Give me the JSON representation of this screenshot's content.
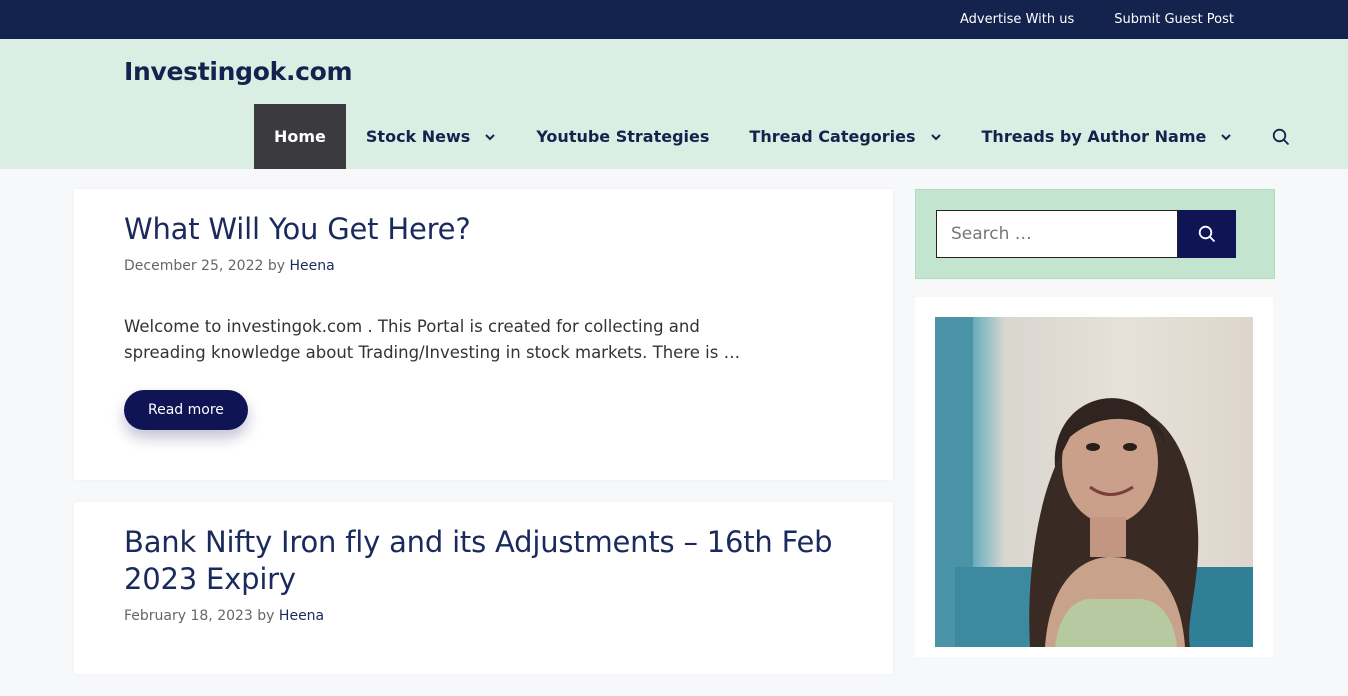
{
  "topbar": {
    "links": [
      "Advertise With us",
      "Submit Guest Post"
    ]
  },
  "site": {
    "title": "Investingok.com"
  },
  "nav": {
    "items": [
      {
        "label": "Home",
        "active": true,
        "dropdown": false
      },
      {
        "label": "Stock News",
        "active": false,
        "dropdown": true
      },
      {
        "label": "Youtube Strategies",
        "active": false,
        "dropdown": false
      },
      {
        "label": "Thread Categories",
        "active": false,
        "dropdown": true
      },
      {
        "label": "Threads by Author Name",
        "active": false,
        "dropdown": true
      }
    ],
    "search_icon": "search-icon"
  },
  "posts": [
    {
      "title": "What Will You Get Here?",
      "date": "December 25, 2022",
      "by": "by",
      "author": "Heena",
      "excerpt": "Welcome to investingok.com . This Portal is created for collecting and spreading knowledge about Trading/Investing in stock markets. There is …",
      "read_more": "Read more"
    },
    {
      "title": "Bank Nifty Iron fly and its Adjustments – 16th Feb 2023 Expiry",
      "date": "February 18, 2023",
      "by": "by",
      "author": "Heena"
    }
  ],
  "sidebar": {
    "search_placeholder": "Search …",
    "search_icon": "search-icon"
  },
  "colors": {
    "topbar": "#14224e",
    "header_bg": "#daeee3",
    "accent": "#0e1454",
    "search_widget_bg": "#c3e4cf"
  }
}
